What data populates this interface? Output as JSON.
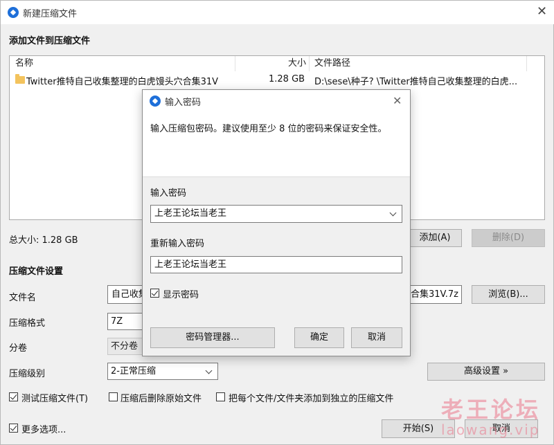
{
  "window": {
    "title": "新建压缩文件",
    "section_add": "添加文件到压缩文件"
  },
  "file_list": {
    "columns": [
      "名称",
      "大小",
      "文件路径"
    ],
    "rows": [
      {
        "name": "Twitter推特自己收集整理的白虎馒头穴合集31V",
        "size": "1.28 GB",
        "path": "D:\\sese\\种子? \\Twitter推特自己收集整理的白虎..."
      }
    ]
  },
  "total_size": "总大小: 1.28 GB",
  "buttons": {
    "add": "添加(A)",
    "delete": "删除(D)",
    "browse": "浏览(B)...",
    "advanced": "高级设置 »",
    "start": "开始(S)",
    "cancel": "取消"
  },
  "settings": {
    "section_title": "压缩文件设置",
    "filename_label": "文件名",
    "filename_value_left": "自己收集",
    "filename_value_right": "穴合集31V.7z",
    "format_label": "压缩格式",
    "format_value": "7Z",
    "volume_label": "分卷",
    "volume_value": "不分卷",
    "level_label": "压缩级别",
    "level_value": "2-正常压缩"
  },
  "options": {
    "test_label": "测试压缩文件(T)",
    "test_checked": true,
    "delete_source_label": "压缩后删除原始文件",
    "delete_source_checked": false,
    "separate_label": "把每个文件/文件夹添加到独立的压缩文件",
    "separate_checked": false,
    "more_label": "更多选项...",
    "more_checked": true
  },
  "password_dialog": {
    "title": "输入密码",
    "hint": "输入压缩包密码。建议使用至少 8 位的密码来保证安全性。",
    "password_label": "输入密码",
    "password_value": "上老王论坛当老王",
    "reenter_label": "重新输入密码",
    "reenter_value": "上老王论坛当老王",
    "show_password_label": "显示密码",
    "show_password_checked": true,
    "manager_button": "密码管理器...",
    "ok_button": "确定",
    "cancel_button": "取消"
  },
  "watermark": {
    "text": "老王论坛",
    "url": "laowang.vip",
    "color": "#eb788c"
  },
  "colors": {
    "accent": "#1e6fd9",
    "window_bg": "#f0f0f0",
    "folder": "#f3c35d"
  }
}
